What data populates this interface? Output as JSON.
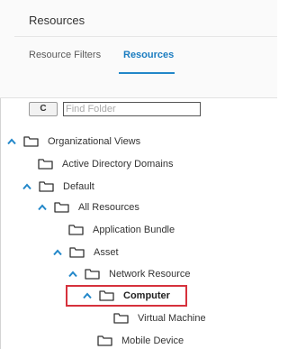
{
  "panel": {
    "title": "Resources"
  },
  "tabs": [
    {
      "label": "Resource Filters",
      "active": false
    },
    {
      "label": "Resources",
      "active": true
    }
  ],
  "toolbar": {
    "refresh_icon": "refresh-icon",
    "refresh_glyph": "C"
  },
  "search": {
    "placeholder": "Find Folder",
    "value": ""
  },
  "tree": [
    {
      "label": "Organizational Views",
      "expanded": true,
      "depth": 0
    },
    {
      "label": "Active Directory Domains",
      "expanded": false,
      "depth": 1
    },
    {
      "label": "Default",
      "expanded": true,
      "depth": 1
    },
    {
      "label": "All Resources",
      "expanded": true,
      "depth": 2
    },
    {
      "label": "Application Bundle",
      "expanded": false,
      "depth": 3
    },
    {
      "label": "Asset",
      "expanded": true,
      "depth": 3
    },
    {
      "label": "Network Resource",
      "expanded": true,
      "depth": 4
    },
    {
      "label": "Computer",
      "expanded": true,
      "depth": 5,
      "selected": true
    },
    {
      "label": "Virtual Machine",
      "expanded": false,
      "depth": 6
    },
    {
      "label": "Mobile Device",
      "expanded": false,
      "depth": 5
    }
  ],
  "colors": {
    "accent": "#1a7cc0",
    "chevron": "#2287c9",
    "highlight": "#d6313c"
  }
}
